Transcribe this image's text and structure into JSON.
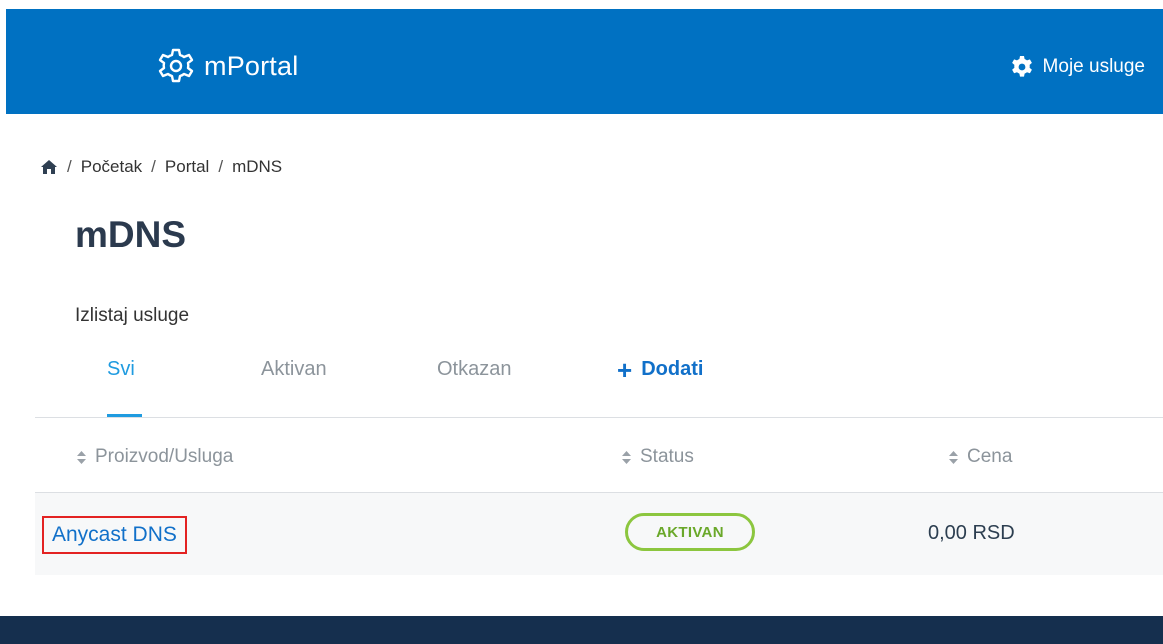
{
  "header": {
    "logo_text": "mPortal",
    "services_label": "Moje usluge",
    "colors": {
      "bar": "#0071c2",
      "text": "#ffffff"
    }
  },
  "breadcrumb": {
    "icon": "home-icon",
    "items": [
      "Početak",
      "Portal",
      "mDNS"
    ],
    "separator": "/"
  },
  "page": {
    "title": "mDNS",
    "subtitle": "Izlistaj usluge"
  },
  "tabs": {
    "items": [
      {
        "label": "Svi",
        "active": true
      },
      {
        "label": "Aktivan",
        "active": false
      },
      {
        "label": "Otkazan",
        "active": false
      }
    ],
    "add_label": "Dodati",
    "add_icon": "plus-icon"
  },
  "table": {
    "columns": [
      "Proizvod/Usluga",
      "Status",
      "Cena"
    ],
    "rows": [
      {
        "product": "Anycast DNS",
        "status": "AKTIVAN",
        "price": "0,00 RSD"
      }
    ]
  },
  "colors": {
    "accent": "#1f9be0",
    "link": "#1170c9",
    "status_active": "#8cc63f",
    "highlight_box": "#e32222",
    "footer": "#152f4e"
  }
}
